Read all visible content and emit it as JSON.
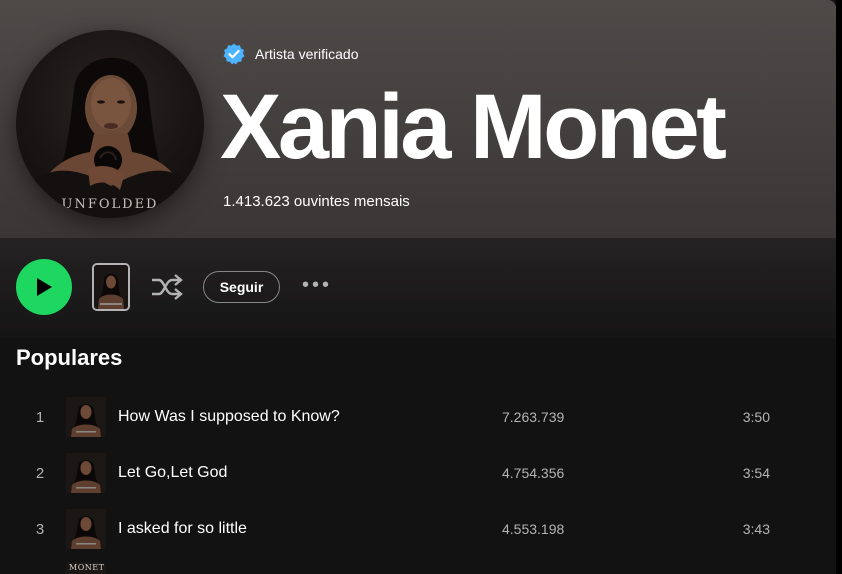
{
  "artist": {
    "verified_label": "Artista verificado",
    "name": "Xania Monet",
    "monthly_listeners": "1.413.623 ouvintes mensais",
    "avatar_caption": "UNFOLDED"
  },
  "controls": {
    "follow_label": "Seguir",
    "more_label": "•••"
  },
  "popular": {
    "title": "Populares",
    "tracks": [
      {
        "index": "1",
        "title": "How Was I supposed to Know?",
        "plays": "7.263.739",
        "duration": "3:50"
      },
      {
        "index": "2",
        "title": "Let Go,Let God",
        "plays": "4.754.356",
        "duration": "3:54"
      },
      {
        "index": "3",
        "title": "I asked for so little",
        "plays": "4.553.198",
        "duration": "3:43"
      }
    ],
    "next_cover_text": "MONET"
  },
  "colors": {
    "accent_green": "#1ed760",
    "verified_blue": "#4cb3ff",
    "background": "#121212",
    "muted_text": "#b3b3b3"
  }
}
